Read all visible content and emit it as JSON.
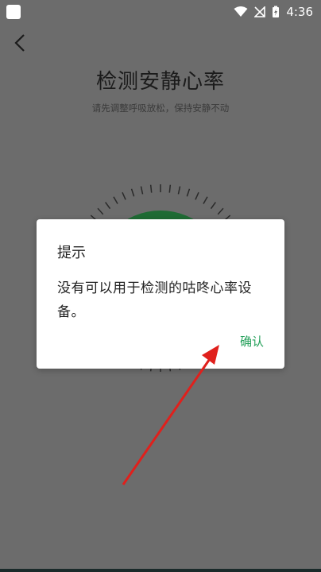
{
  "status": {
    "time": "4:36"
  },
  "screen": {
    "title": "检测安静心率",
    "subtitle": "请先调整呼吸放松，保持安静不动"
  },
  "dialog": {
    "title": "提示",
    "message": "没有可以用于检测的咕咚心率设备。",
    "confirm_label": "确认"
  },
  "colors": {
    "overlay": "#6c6c6c",
    "accent": "#24a05a",
    "dial_green": "#1f6b34",
    "arrow": "#e0201c"
  },
  "icons": [
    "wifi-icon",
    "no-signal-icon",
    "battery-charging-icon",
    "back-arrow-icon"
  ]
}
